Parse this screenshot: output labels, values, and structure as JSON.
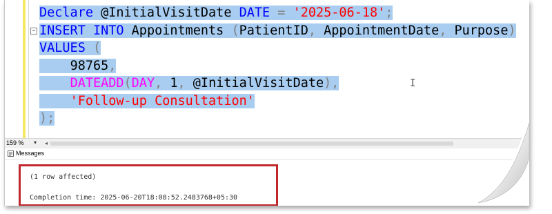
{
  "editor": {
    "line1": {
      "kw1": "Declare",
      "var": " @InitialVisitDate",
      "kw2": " DATE",
      "eq": " =",
      "str": " '2025-06-18'",
      "semi": ";"
    },
    "line2": {
      "kw": "INSERT INTO",
      "table": " Appointments",
      "open": " (",
      "col1": "PatientID",
      "comma1": ",",
      "col2": " AppointmentDate",
      "comma2": ",",
      "col3": " Purpose",
      "close": ")"
    },
    "line3": {
      "kw": "VALUES",
      "open": " ("
    },
    "line4": {
      "indent": "    ",
      "num": "98765",
      "comma": ","
    },
    "line5": {
      "indent": "    ",
      "fn": "DATEADD",
      "open": "(",
      "arg1": "DAY",
      "c1": ",",
      "arg2": " 1",
      "c2": ",",
      "arg3": " @InitialVisitDate",
      "close": ")",
      "comma": ","
    },
    "line6": {
      "indent": "    ",
      "str": "'Follow-up Consultation'"
    },
    "line7": {
      "close": ");"
    },
    "collapse_glyph": "−",
    "cursor_glyph": "I"
  },
  "status": {
    "zoom": "159 %",
    "zoom_arrow": "▾",
    "scroll_left_arrow": "◂"
  },
  "tabs": {
    "messages_label": "Messages"
  },
  "results": {
    "rows_affected": "(1 row affected)",
    "completion": "Completion time: 2025-06-20T18:08:52.2483768+05:30"
  },
  "colors": {
    "keyword": "#0000ff",
    "string": "#ff0000",
    "function": "#ff00ff",
    "operator": "#808080",
    "selection": "#a8cdf0",
    "highlight_border": "#c0262c"
  },
  "icons": {
    "messages": "messages-icon",
    "collapse": "collapse-minus-icon",
    "text_cursor": "ibeam-cursor-icon"
  }
}
